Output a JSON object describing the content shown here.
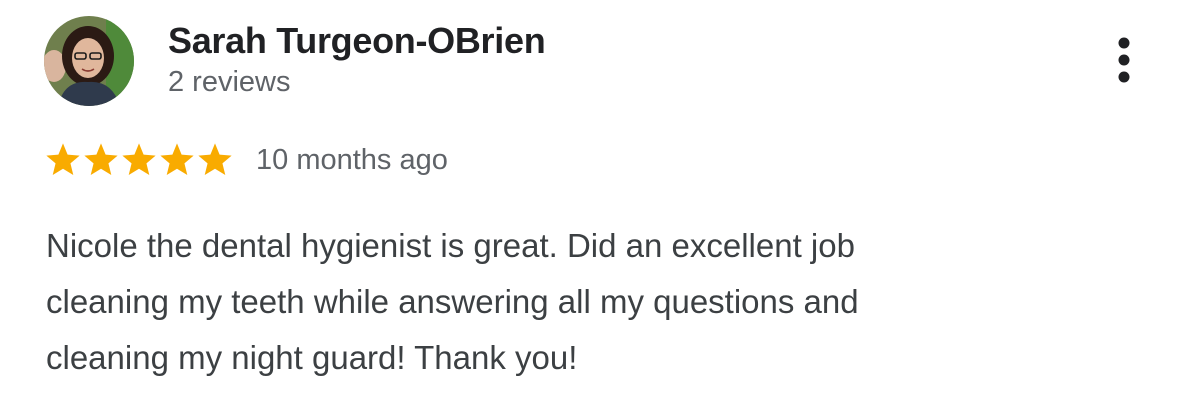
{
  "reviewer": {
    "name": "Sarah Turgeon-OBrien",
    "review_count": "2 reviews",
    "avatar_icon": "person-photo-avatar"
  },
  "more_options": {
    "icon": "more-vertical-icon"
  },
  "rating": {
    "stars": 5,
    "max_stars": 5,
    "star_color": "#f9ab00",
    "time": "10 months ago"
  },
  "review": {
    "lines": [
      "Nicole the dental hygienist is great. Did an excellent job",
      "cleaning my teeth while answering all my questions and",
      "cleaning my night guard! Thank you!"
    ]
  },
  "colors": {
    "name": "#202124",
    "secondary_text": "#5f6368",
    "body_text": "#3c4043",
    "background": "#ffffff"
  }
}
